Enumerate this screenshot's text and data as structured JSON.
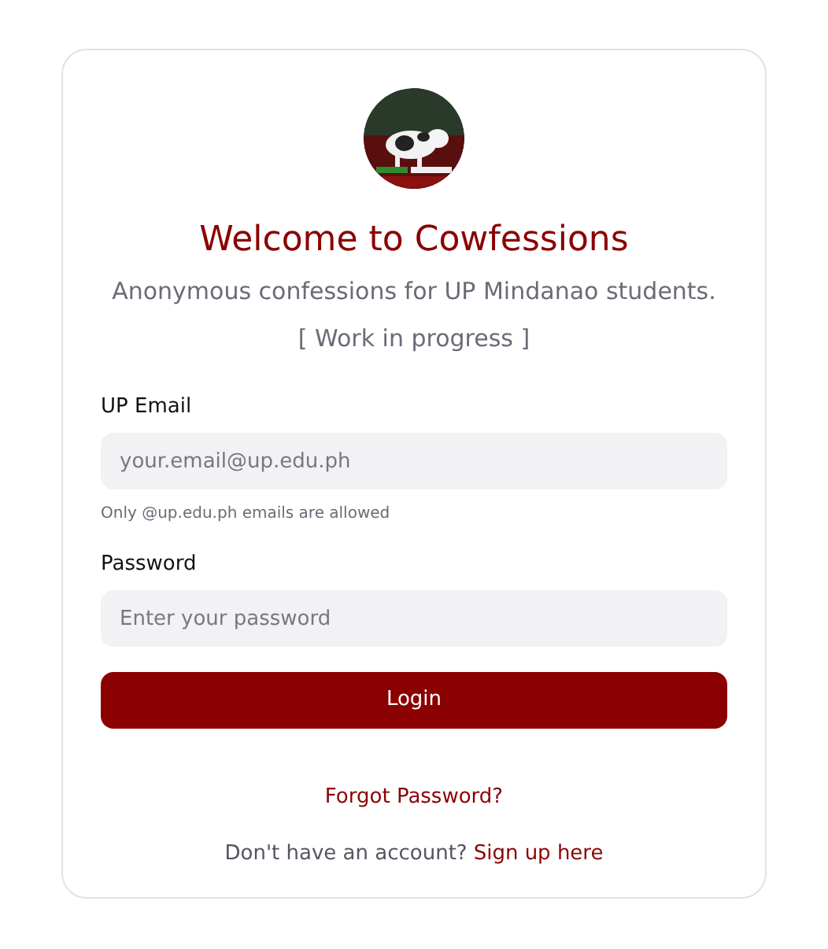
{
  "title": "Welcome to Cowfessions",
  "subtitle": "Anonymous confessions for UP Mindanao students.",
  "note": "[ Work in progress ]",
  "fields": [
    {
      "label": "UP Email",
      "placeholder": "your.email@up.edu.ph",
      "hint": "Only @up.edu.ph emails are allowed"
    },
    {
      "label": "Password",
      "placeholder": "Enter your password"
    }
  ],
  "login_button": "Login",
  "forgot_link": "Forgot Password?",
  "signup": {
    "text": "Don't have an account?",
    "link": "Sign up here"
  }
}
